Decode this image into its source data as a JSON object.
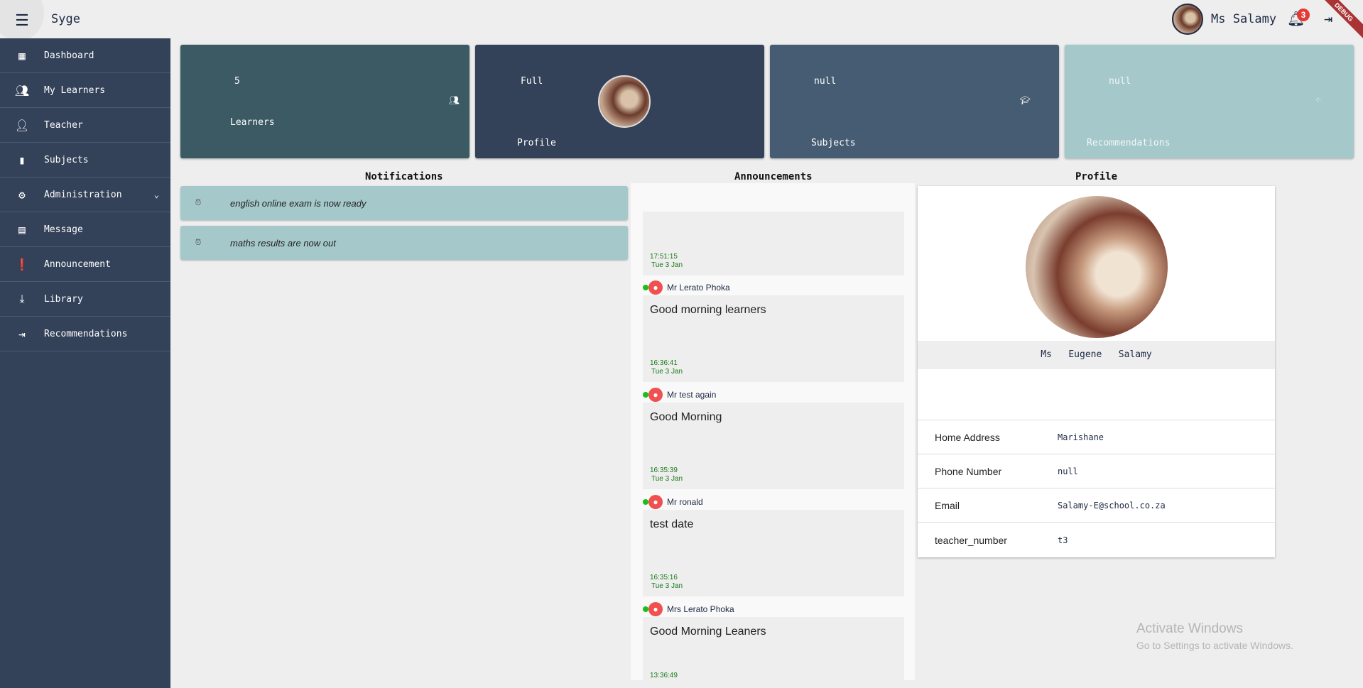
{
  "header": {
    "title": "Syge",
    "user_name": "Ms Salamy",
    "notification_count": "3",
    "debug_label": "DEBUG"
  },
  "sidebar": {
    "items": [
      {
        "label": "Dashboard",
        "icon": "dashboard-icon"
      },
      {
        "label": "My Learners",
        "icon": "people-icon"
      },
      {
        "label": "Teacher",
        "icon": "person-add-icon"
      },
      {
        "label": "Subjects",
        "icon": "book-icon"
      },
      {
        "label": "Administration",
        "icon": "admin-icon"
      },
      {
        "label": "Message",
        "icon": "message-icon"
      },
      {
        "label": "Announcement",
        "icon": "announcement-icon"
      },
      {
        "label": "Library",
        "icon": "download-icon"
      },
      {
        "label": "Recommendations",
        "icon": "recommend-icon"
      }
    ]
  },
  "cards": [
    {
      "value": "5",
      "label": "Learners",
      "color": "#3b5a63"
    },
    {
      "value": "Full",
      "label": "Profile",
      "color": "#334159"
    },
    {
      "value": "null",
      "label": "Subjects",
      "color": "#465c72"
    },
    {
      "value": "null",
      "label": "Recommendations",
      "color": "#a5c8ca"
    }
  ],
  "notifications": {
    "title": "Notifications",
    "items": [
      "english online exam is now ready",
      "maths results are now out"
    ]
  },
  "announcements": {
    "title": "Announcements",
    "items": [
      {
        "author": "",
        "message": "",
        "time": "17:51:15",
        "date": "Tue 3 Jan"
      },
      {
        "author": "Mr  Lerato Phoka",
        "message": "Good morning learners",
        "time": "16:36:41",
        "date": "Tue 3 Jan"
      },
      {
        "author": "Mr  test again",
        "message": "Good Morning",
        "time": "16:35:39",
        "date": "Tue 3 Jan"
      },
      {
        "author": "Mr  ronald",
        "message": "test date",
        "time": "16:35:16",
        "date": "Tue 3 Jan"
      },
      {
        "author": "Mrs  Lerato Phoka",
        "message": "Good Morning Leaners",
        "time": "13:36:49",
        "date": ""
      }
    ]
  },
  "profile": {
    "title": "Profile",
    "full_name": "Ms   Eugene   Salamy",
    "fields": [
      {
        "label": "Home Address",
        "value": "Marishane"
      },
      {
        "label": "Phone Number",
        "value": "null"
      },
      {
        "label": "Email",
        "value": "Salamy-E@school.co.za"
      },
      {
        "label": "teacher_number",
        "value": "t3"
      }
    ]
  },
  "watermark": {
    "title": "Activate Windows",
    "subtitle": "Go to Settings to activate Windows."
  }
}
